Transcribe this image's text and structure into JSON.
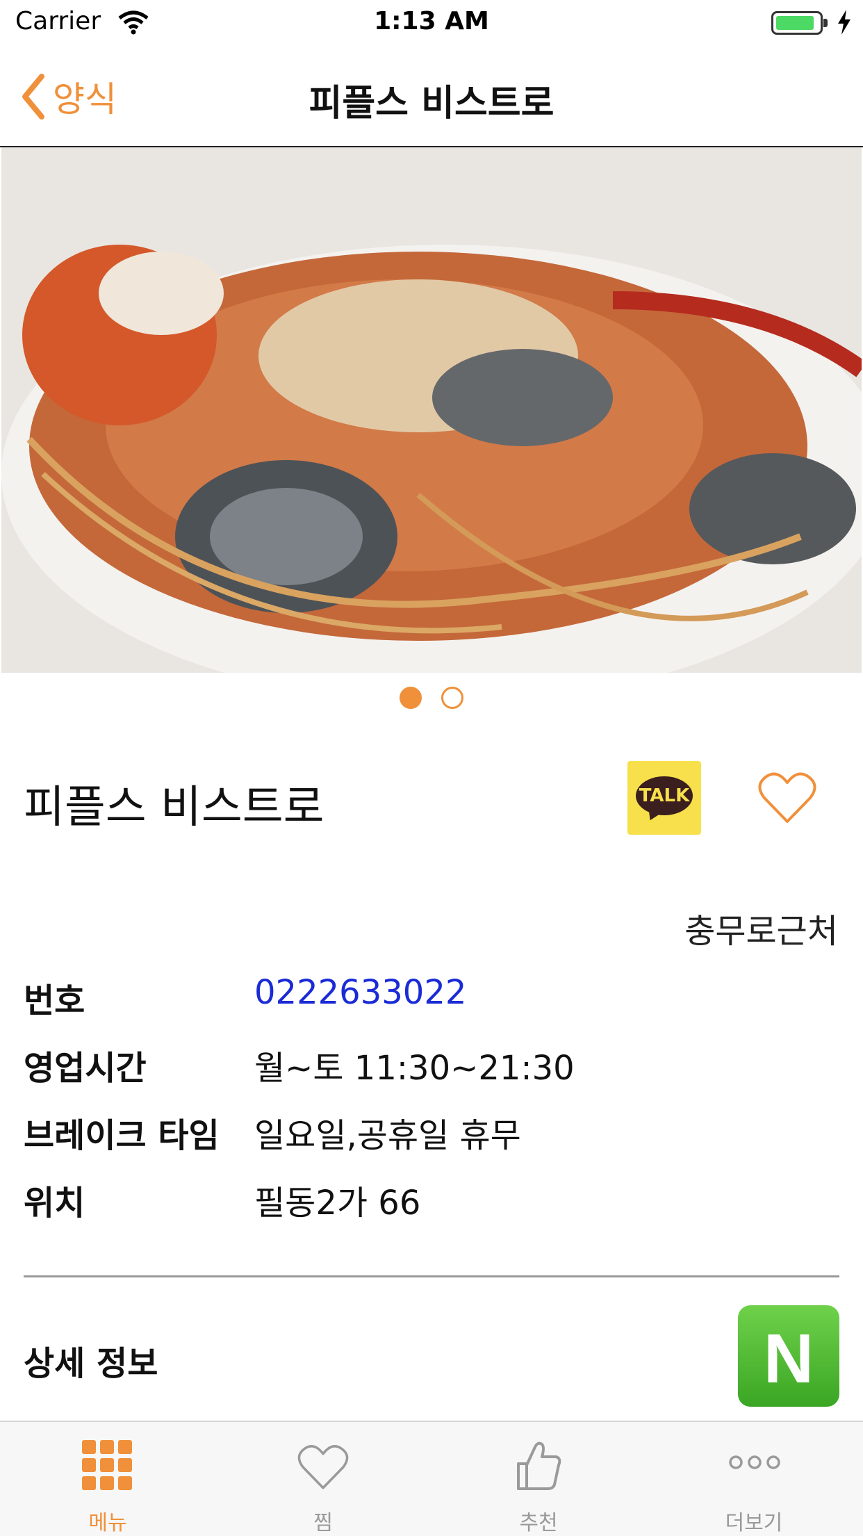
{
  "status_bar": {
    "carrier": "Carrier",
    "time": "1:13 AM"
  },
  "nav": {
    "back_label": "양식",
    "title": "피플스 비스트로"
  },
  "pager": {
    "count": 2,
    "active_index": 0
  },
  "restaurant": {
    "name": "피플스 비스트로",
    "area": "충무로근처",
    "kakao_label": "TALK"
  },
  "info": [
    {
      "key": "번호",
      "value": "0222633022"
    },
    {
      "key": "영업시간",
      "value": "월~토 11:30~21:30"
    },
    {
      "key": "브레이크 타임",
      "value": "일요일,공휴일 휴무"
    },
    {
      "key": "위치",
      "value": "필동2가 66"
    }
  ],
  "detail": {
    "label": "상세 정보",
    "naver_label": "N"
  },
  "tabs": [
    {
      "label": "메뉴",
      "icon": "grid-icon",
      "active": true
    },
    {
      "label": "찜",
      "icon": "heart-icon",
      "active": false
    },
    {
      "label": "추천",
      "icon": "thumbs-up-icon",
      "active": false
    },
    {
      "label": "더보기",
      "icon": "more-icon",
      "active": false
    }
  ],
  "colors": {
    "accent": "#f0903a",
    "link": "#1a2bd6",
    "kakao": "#f7e04b",
    "naver": "#3aa624"
  }
}
